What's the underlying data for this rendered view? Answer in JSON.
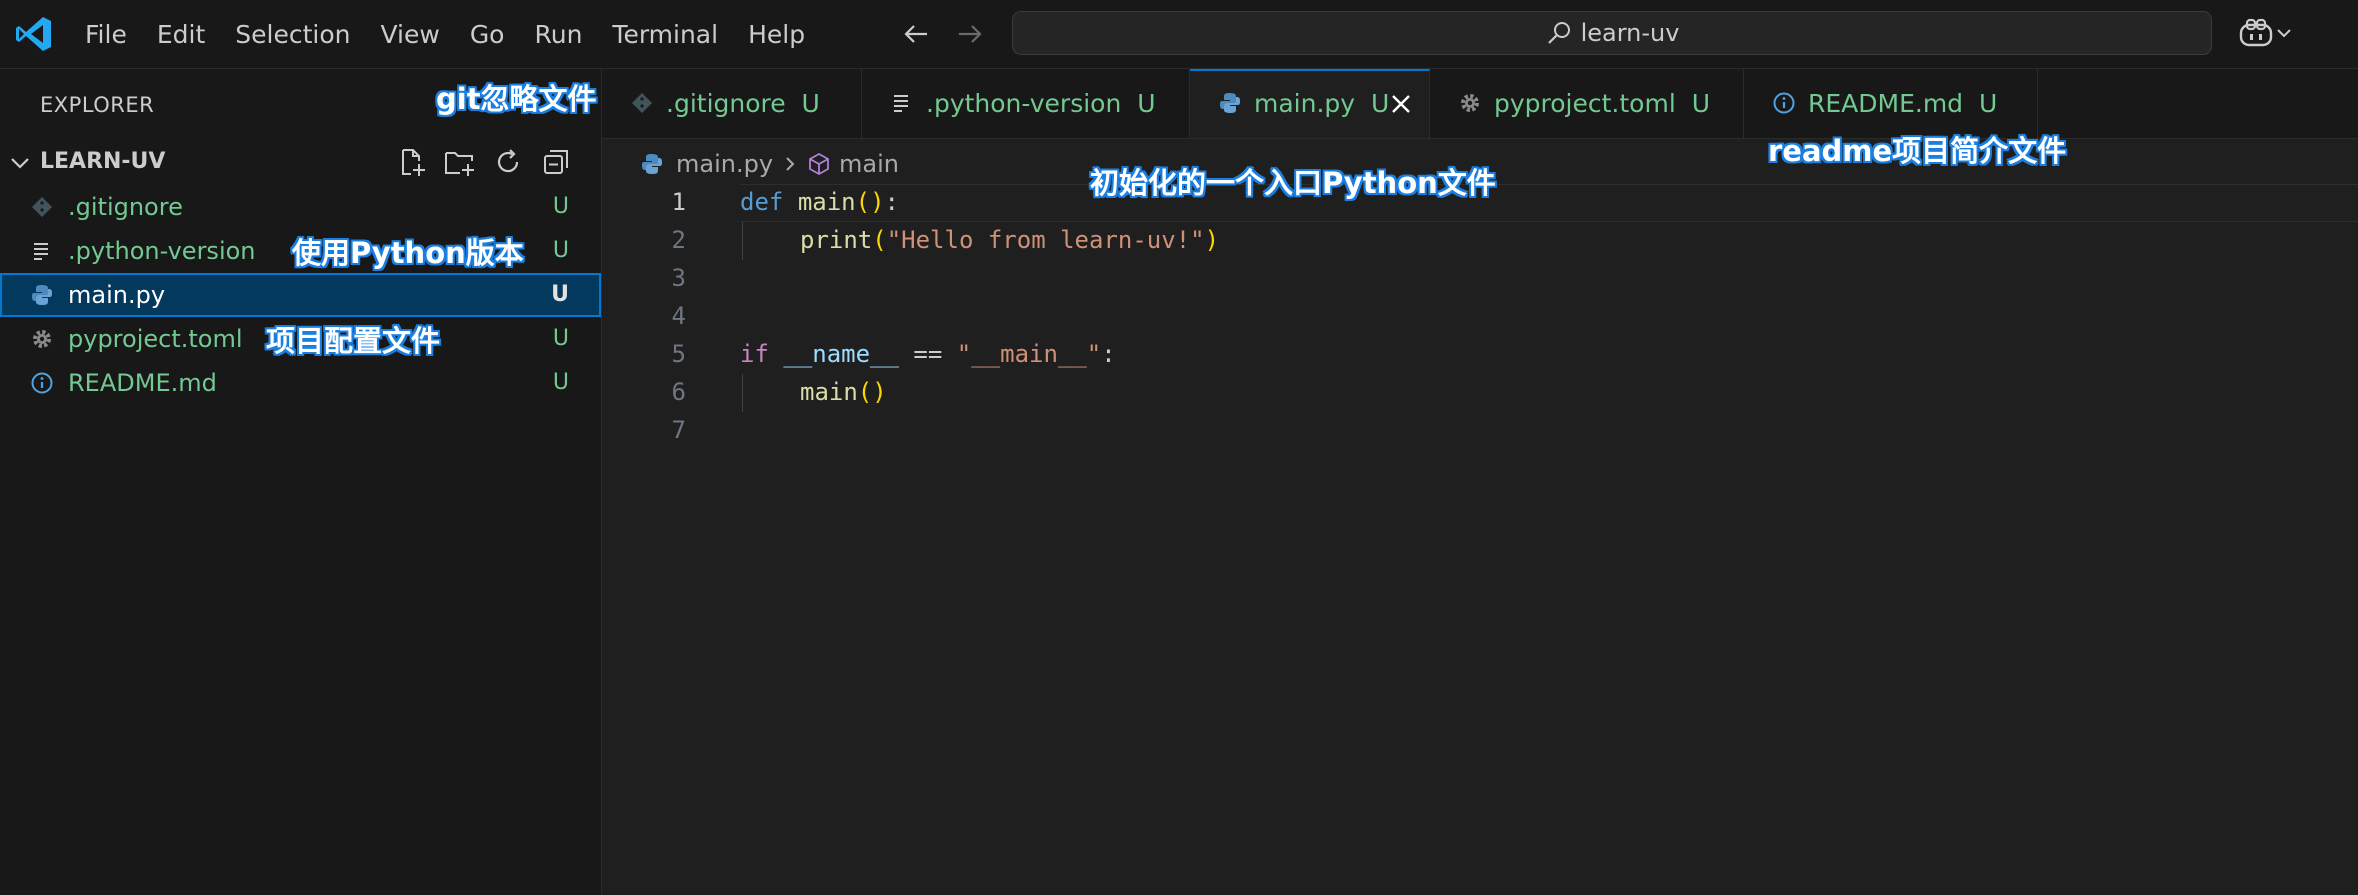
{
  "titlebar": {
    "menu": [
      "File",
      "Edit",
      "Selection",
      "View",
      "Go",
      "Run",
      "Terminal",
      "Help"
    ],
    "search_text": "learn-uv",
    "icons": [
      "vscode-logo-icon",
      "arrow-left-icon",
      "arrow-right-icon",
      "search-icon",
      "copilot-icon",
      "chevron-down-icon"
    ]
  },
  "sidebar": {
    "title": "EXPLORER",
    "section": "LEARN-UV",
    "files": [
      {
        "name": ".gitignore",
        "status": "U",
        "icon": "git-icon"
      },
      {
        "name": ".python-version",
        "status": "U",
        "icon": "lines-icon"
      },
      {
        "name": "main.py",
        "status": "U",
        "icon": "python-icon",
        "selected": true
      },
      {
        "name": "pyproject.toml",
        "status": "U",
        "icon": "gear-icon"
      },
      {
        "name": "README.md",
        "status": "U",
        "icon": "info-icon"
      }
    ]
  },
  "tabs": [
    {
      "label": ".gitignore",
      "status": "U"
    },
    {
      "label": ".python-version",
      "status": "U"
    },
    {
      "label": "main.py",
      "status": "U",
      "active": true
    },
    {
      "label": "pyproject.toml",
      "status": "U"
    },
    {
      "label": "README.md",
      "status": "U"
    }
  ],
  "breadcrumb": {
    "file": "main.py",
    "symbol": "main"
  },
  "editor": {
    "line_numbers": [
      "1",
      "2",
      "3",
      "4",
      "5",
      "6",
      "7"
    ],
    "current_line": 1,
    "code": {
      "l1_kw": "def",
      "l1_fn": "main",
      "l1_open": "(",
      "l1_close": ")",
      "l1_colon": ":",
      "l2_fn": "print",
      "l2_open": "(",
      "l2_str": "\"Hello from learn-uv!\"",
      "l2_close": ")",
      "l5_kw": "if",
      "l5_var": "__name__",
      "l5_op": "==",
      "l5_str": "\"__main__\"",
      "l5_colon": ":",
      "l6_fn": "main",
      "l6_open": "(",
      "l6_close": ")"
    }
  },
  "annotations": {
    "gitignore": "git忽略文件",
    "python_version": "使用Python版本",
    "pyproject": "项目配置文件",
    "main_entry": "初始化的一个入口Python文件",
    "readme": "readme项目简介文件"
  },
  "colors": {
    "accent": "#0078d4",
    "untracked": "#73c991",
    "annotation_outline": "#1a7fe0"
  }
}
